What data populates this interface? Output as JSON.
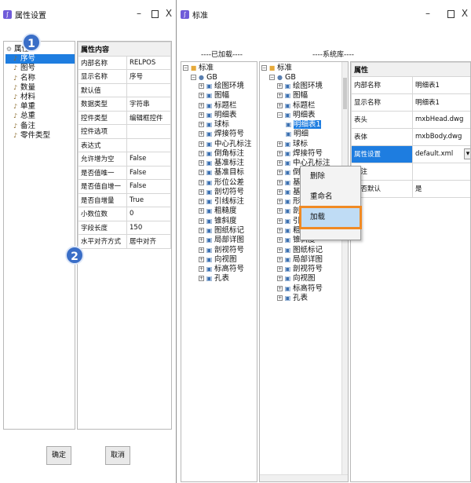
{
  "left_window": {
    "title": "属性设置",
    "tree": [
      "属性",
      "序号",
      "图号",
      "名称",
      "数量",
      "材料",
      "单重",
      "总重",
      "备注",
      "零件类型"
    ],
    "grid_header": "属性内容",
    "props": [
      [
        "内部名称",
        "RELPOS"
      ],
      [
        "显示名称",
        "序号"
      ],
      [
        "默认值",
        ""
      ],
      [
        "数据类型",
        "字符串"
      ],
      [
        "控件类型",
        "编辑框控件"
      ],
      [
        "控件选项",
        ""
      ],
      [
        "表达式",
        ""
      ],
      [
        "允许增为空",
        "False"
      ],
      [
        "是否值唯一",
        "False"
      ],
      [
        "是否值自增一",
        "False"
      ],
      [
        "是否自增量",
        "True"
      ],
      [
        "小数位数",
        "0"
      ],
      [
        "字段长度",
        "150"
      ],
      [
        "水平对齐方式",
        "居中对齐"
      ]
    ],
    "ok_label": "确定",
    "cancel_label": "取消"
  },
  "badges": {
    "one": "1",
    "two": "2"
  },
  "right_window": {
    "title": "标准",
    "loaded_label": "----已加载----",
    "library_label": "----系统库----",
    "tree_root": "标准",
    "tree_child": "GB",
    "left_items": [
      "绘图环境",
      "图幅",
      "标题栏",
      "明细表",
      "球标",
      "焊接符号",
      "中心孔标注",
      "倒角标注",
      "基准标注",
      "基准目标",
      "形位公差",
      "剖切符号",
      "引线标注",
      "粗糙度",
      "锥斜度",
      "图纸标记",
      "局部详图",
      "剖视符号",
      "向视图",
      "标高符号",
      "孔表"
    ],
    "right_items_top": [
      "绘图环境",
      "图幅",
      "标题栏"
    ],
    "mx_label": "明细表",
    "mx_children": [
      "明细表1",
      "明细"
    ],
    "right_items_mid": [
      "球标",
      "焊接符号",
      "中心孔标注",
      "倒角标注",
      "基准标注",
      "基准目标",
      "形位公差",
      "剖切符号",
      "引线标注",
      "粗糙度",
      "锥斜度",
      "图纸标记",
      "局部详图",
      "剖视符号",
      "向视图",
      "标高符号",
      "孔表"
    ],
    "context_menu": [
      "删除",
      "重命名",
      "加载"
    ],
    "grid_header": "属性",
    "props": [
      [
        "内部名称",
        "明细表1"
      ],
      [
        "显示名称",
        "明细表1"
      ],
      [
        "表头",
        "mxbHead.dwg"
      ],
      [
        "表体",
        "mxbBody.dwg"
      ],
      [
        "属性设置",
        "default.xml"
      ],
      [
        "备注",
        ""
      ],
      [
        "是否默认",
        "是"
      ]
    ],
    "highlight_row": 4
  }
}
